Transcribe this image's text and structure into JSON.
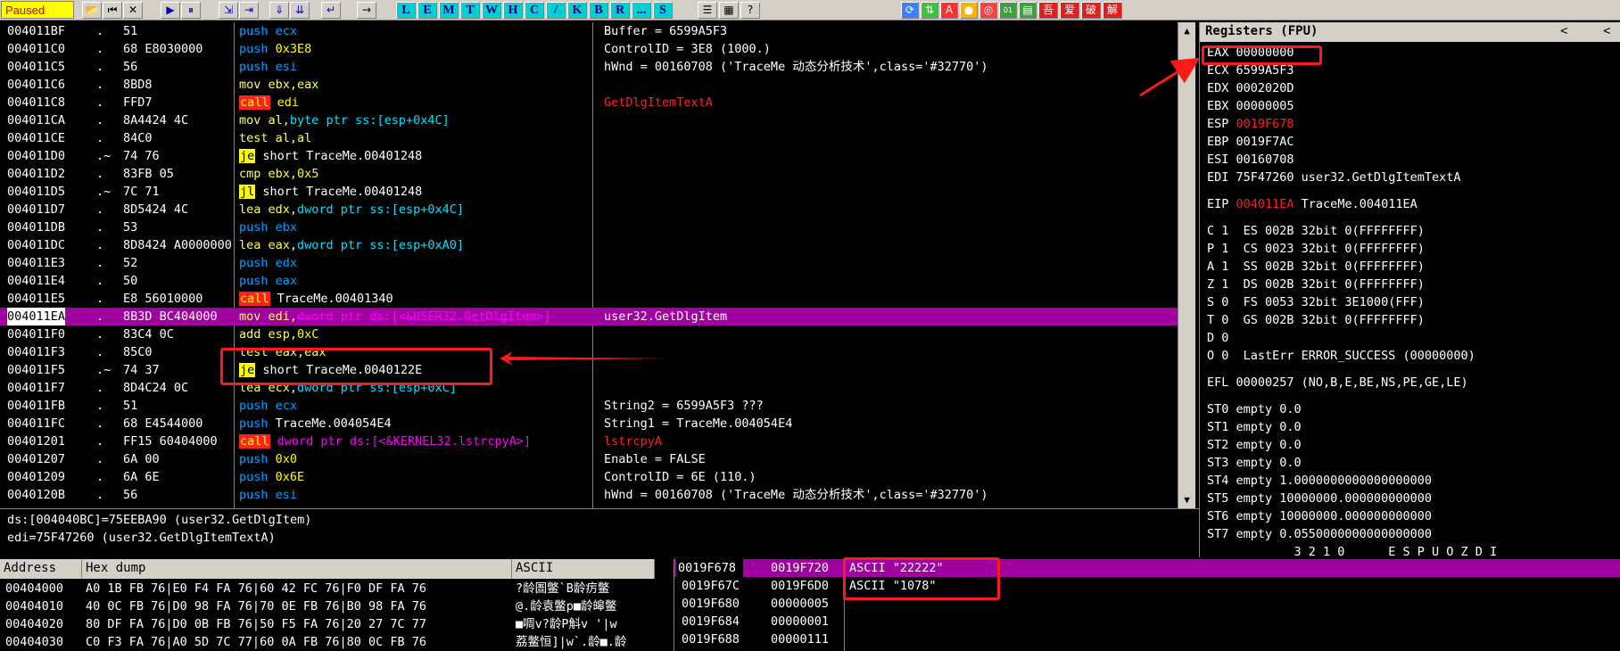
{
  "toolbar": {
    "status": "Paused",
    "letters": [
      "L",
      "E",
      "M",
      "T",
      "W",
      "H",
      "C",
      "/",
      "K",
      "B",
      "R",
      "...",
      "S"
    ],
    "question": "?",
    "right_icons": [
      "吾",
      "爱",
      "破",
      "解"
    ]
  },
  "cpu": {
    "rows": [
      {
        "addr": "004011BF",
        "mk": ".",
        "hex": "51",
        "asm": [
          {
            "t": "push",
            "k": "push"
          },
          {
            "t": " ecx",
            "k": "push"
          }
        ],
        "cmt": "Buffer = 6599A5F3"
      },
      {
        "addr": "004011C0",
        "mk": ".",
        "hex": "68 E8030000",
        "asm": [
          {
            "t": "push",
            "k": "push"
          },
          {
            "t": " 0x3E8",
            "k": "imm"
          }
        ],
        "cmt": "ControlID = 3E8 (1000.)"
      },
      {
        "addr": "004011C5",
        "mk": ".",
        "hex": "56",
        "asm": [
          {
            "t": "push",
            "k": "push"
          },
          {
            "t": " esi",
            "k": "push"
          }
        ],
        "cmt": "hWnd = 00160708 ('TraceMe 动态分析技术',class='#32770')"
      },
      {
        "addr": "004011C6",
        "mk": ".",
        "hex": "8BD8",
        "asm": [
          {
            "t": "mov ebx,eax",
            "k": "mov"
          }
        ],
        "cmt": ""
      },
      {
        "addr": "004011C8",
        "mk": ".",
        "hex": "FFD7",
        "asm": [
          {
            "t": "call",
            "k": "call"
          },
          {
            "t": " edi",
            "k": "imm"
          }
        ],
        "cmt": "GetDlgItemTextA",
        "cmt_api": true
      },
      {
        "addr": "004011CA",
        "mk": ".",
        "hex": "8A4424 4C",
        "asm": [
          {
            "t": "mov al,",
            "k": "mov"
          },
          {
            "t": "byte ptr ss:[esp+0x4C]",
            "k": "reg"
          }
        ],
        "cmt": ""
      },
      {
        "addr": "004011CE",
        "mk": ".",
        "hex": "84C0",
        "asm": [
          {
            "t": "test al,al",
            "k": "mov"
          }
        ],
        "cmt": ""
      },
      {
        "addr": "004011D0",
        "mk": ".~",
        "hex": "74 76",
        "asm": [
          {
            "t": "je",
            "k": "jmp"
          },
          {
            "t": " short TraceMe.00401248",
            "k": "plain"
          }
        ],
        "cmt": ""
      },
      {
        "addr": "004011D2",
        "mk": ".",
        "hex": "83FB 05",
        "asm": [
          {
            "t": "cmp ebx,",
            "k": "mov"
          },
          {
            "t": "0x5",
            "k": "imm"
          }
        ],
        "cmt": ""
      },
      {
        "addr": "004011D5",
        "mk": ".~",
        "hex": "7C 71",
        "asm": [
          {
            "t": "jl",
            "k": "jmp"
          },
          {
            "t": " short TraceMe.00401248",
            "k": "plain"
          }
        ],
        "cmt": ""
      },
      {
        "addr": "004011D7",
        "mk": ".",
        "hex": "8D5424 4C",
        "asm": [
          {
            "t": "lea edx,",
            "k": "mov"
          },
          {
            "t": "dword ptr ss:[esp+0x4C]",
            "k": "reg"
          }
        ],
        "cmt": ""
      },
      {
        "addr": "004011DB",
        "mk": ".",
        "hex": "53",
        "asm": [
          {
            "t": "push",
            "k": "push"
          },
          {
            "t": " ebx",
            "k": "push"
          }
        ],
        "cmt": ""
      },
      {
        "addr": "004011DC",
        "mk": ".",
        "hex": "8D8424 A0000000",
        "asm": [
          {
            "t": "lea eax,",
            "k": "mov"
          },
          {
            "t": "dword ptr ss:[esp+0xA0]",
            "k": "reg"
          }
        ],
        "cmt": ""
      },
      {
        "addr": "004011E3",
        "mk": ".",
        "hex": "52",
        "asm": [
          {
            "t": "push",
            "k": "push"
          },
          {
            "t": " edx",
            "k": "push"
          }
        ],
        "cmt": ""
      },
      {
        "addr": "004011E4",
        "mk": ".",
        "hex": "50",
        "asm": [
          {
            "t": "push",
            "k": "push"
          },
          {
            "t": " eax",
            "k": "push"
          }
        ],
        "cmt": ""
      },
      {
        "addr": "004011E5",
        "mk": ".",
        "hex": "E8 56010000",
        "asm": [
          {
            "t": "call",
            "k": "call"
          },
          {
            "t": " TraceMe.00401340",
            "k": "plain"
          }
        ],
        "cmt": ""
      },
      {
        "addr": "004011EA",
        "mk": ".",
        "hex": "8B3D BC404000",
        "asm": [
          {
            "t": "mov edi,",
            "k": "mov"
          },
          {
            "t": "dword ptr ds:[<&USER32.GetDlgItem>]",
            "k": "ref"
          }
        ],
        "cmt": "user32.GetDlgItem",
        "hl": true
      },
      {
        "addr": "004011F0",
        "mk": ".",
        "hex": "83C4 0C",
        "asm": [
          {
            "t": "add esp,",
            "k": "mov"
          },
          {
            "t": "0xC",
            "k": "imm"
          }
        ],
        "cmt": ""
      },
      {
        "addr": "004011F3",
        "mk": ".",
        "hex": "85C0",
        "asm": [
          {
            "t": "test eax,eax",
            "k": "mov"
          }
        ],
        "cmt": ""
      },
      {
        "addr": "004011F5",
        "mk": ".~",
        "hex": "74 37",
        "asm": [
          {
            "t": "je",
            "k": "jmp"
          },
          {
            "t": " short TraceMe.0040122E",
            "k": "plain"
          }
        ],
        "cmt": ""
      },
      {
        "addr": "004011F7",
        "mk": ".",
        "hex": "8D4C24 0C",
        "asm": [
          {
            "t": "lea ecx,",
            "k": "mov"
          },
          {
            "t": "dword ptr ss:[esp+0xC]",
            "k": "reg"
          }
        ],
        "cmt": ""
      },
      {
        "addr": "004011FB",
        "mk": ".",
        "hex": "51",
        "asm": [
          {
            "t": "push",
            "k": "push"
          },
          {
            "t": " ecx",
            "k": "push"
          }
        ],
        "cmt": "String2 = 6599A5F3 ???"
      },
      {
        "addr": "004011FC",
        "mk": ".",
        "hex": "68 E4544000",
        "asm": [
          {
            "t": "push",
            "k": "push"
          },
          {
            "t": " TraceMe.004054E4",
            "k": "plain"
          }
        ],
        "cmt": "String1 = TraceMe.004054E4"
      },
      {
        "addr": "00401201",
        "mk": ".",
        "hex": "FF15 60404000",
        "asm": [
          {
            "t": "call",
            "k": "call"
          },
          {
            "t": " dword ptr ds:[<&KERNEL32.lstrcpyA>]",
            "k": "ref"
          }
        ],
        "cmt": "lstrcpyA",
        "cmt_api": true
      },
      {
        "addr": "00401207",
        "mk": ".",
        "hex": "6A 00",
        "asm": [
          {
            "t": "push",
            "k": "push"
          },
          {
            "t": " 0x0",
            "k": "imm"
          }
        ],
        "cmt": "Enable = FALSE"
      },
      {
        "addr": "00401209",
        "mk": ".",
        "hex": "6A 6E",
        "asm": [
          {
            "t": "push",
            "k": "push"
          },
          {
            "t": " 0x6E",
            "k": "imm"
          }
        ],
        "cmt": "ControlID = 6E (110.)"
      },
      {
        "addr": "0040120B",
        "mk": ".",
        "hex": "56",
        "asm": [
          {
            "t": "push",
            "k": "push"
          },
          {
            "t": " esi",
            "k": "push"
          }
        ],
        "cmt": "hWnd = 00160708 ('TraceMe 动态分析技术',class='#32770')"
      }
    ]
  },
  "registers": {
    "title": "Registers (FPU)",
    "nav_left": "<",
    "nav_right": "<",
    "lines": [
      {
        "t": "EAX 00000000",
        "y": 0
      },
      {
        "t": "ECX 6599A5F3",
        "y": 1
      },
      {
        "t": "EDX 0002020D",
        "y": 2
      },
      {
        "t": "EBX 00000005",
        "y": 3
      },
      {
        "t": "ESP 0019F678",
        "y": 4,
        "red": "0019F678"
      },
      {
        "t": "EBP 0019F7AC",
        "y": 5
      },
      {
        "t": "ESI 00160708",
        "y": 6
      },
      {
        "t": "EDI 75F47260 user32.GetDlgItemTextA",
        "y": 7
      },
      {
        "t": "EIP 004011EA TraceMe.004011EA",
        "y": 8.5,
        "red": "004011EA"
      },
      {
        "t": "C 1  ES 002B 32bit 0(FFFFFFFF)",
        "y": 10
      },
      {
        "t": "P 1  CS 0023 32bit 0(FFFFFFFF)",
        "y": 11
      },
      {
        "t": "A 1  SS 002B 32bit 0(FFFFFFFF)",
        "y": 12
      },
      {
        "t": "Z 1  DS 002B 32bit 0(FFFFFFFF)",
        "y": 13
      },
      {
        "t": "S 0  FS 0053 32bit 3E1000(FFF)",
        "y": 14
      },
      {
        "t": "T 0  GS 002B 32bit 0(FFFFFFFF)",
        "y": 15
      },
      {
        "t": "D 0",
        "y": 16
      },
      {
        "t": "O 0  LastErr ERROR_SUCCESS (00000000)",
        "y": 17
      },
      {
        "t": "EFL 00000257 (NO,B,E,BE,NS,PE,GE,LE)",
        "y": 18.5
      },
      {
        "t": "ST0 empty 0.0",
        "y": 20
      },
      {
        "t": "ST1 empty 0.0",
        "y": 21
      },
      {
        "t": "ST2 empty 0.0",
        "y": 22
      },
      {
        "t": "ST3 empty 0.0",
        "y": 23
      },
      {
        "t": "ST4 empty 1.0000000000000000000",
        "y": 24
      },
      {
        "t": "ST5 empty 10000000.000000000000",
        "y": 25
      },
      {
        "t": "ST6 empty 10000000.000000000000",
        "y": 26
      },
      {
        "t": "ST7 empty 0.0550000000000000000",
        "y": 27
      },
      {
        "t": "            3 2 1 0      E S P U O Z D I",
        "y": 28
      }
    ]
  },
  "info": {
    "line1": "ds:[004040BC]=75EEBA90 (user32.GetDlgItem)",
    "line2": "edi=75F47260 (user32.GetDlgItemTextA)"
  },
  "dump": {
    "headers": {
      "address": "Address",
      "hex": "Hex dump",
      "ascii": "ASCII"
    },
    "rows": [
      {
        "addr": "00404000",
        "hex": "A0 1B FB 76|E0 F4 FA 76|60 42 FC 76|F0 DF FA 76",
        "ascii": "?龄圄鳖`B龄疠鳖"
      },
      {
        "addr": "00404010",
        "hex": "40 0C FB 76|D0 98 FA 76|70 0E FB 76|B0 98 FA 76",
        "ascii": "@.龄袁鳖p■龄皞鳖"
      },
      {
        "addr": "00404020",
        "hex": "80 DF FA 76|D0 0B FB 76|50 F5 FA 76|20 27 7C 77",
        "ascii": "■啁v?龄P斛v '|w"
      },
      {
        "addr": "00404030",
        "hex": "C0 F3 FA 76|A0 5D 7C 77|60 0A FB 76|80 0C FB 76",
        "ascii": "荔鳖恒]|w`.龄■.龄"
      }
    ]
  },
  "stack": {
    "rows": [
      {
        "addr": "0019F678",
        "val": "0019F720",
        "cmt": "ASCII \"22222\"",
        "sel": true
      },
      {
        "addr": "0019F67C",
        "val": "0019F6D0",
        "cmt": "ASCII \"1078\""
      },
      {
        "addr": "0019F680",
        "val": "00000005",
        "cmt": ""
      },
      {
        "addr": "0019F684",
        "val": "00000001",
        "cmt": ""
      },
      {
        "addr": "0019F688",
        "val": "00000111",
        "cmt": ""
      }
    ]
  },
  "colors": {
    "highlight": "#a000a0",
    "annotation": "#ff1a1a",
    "toolbar_bg": "#d4d0c8",
    "status_bg": "#ffff00"
  }
}
